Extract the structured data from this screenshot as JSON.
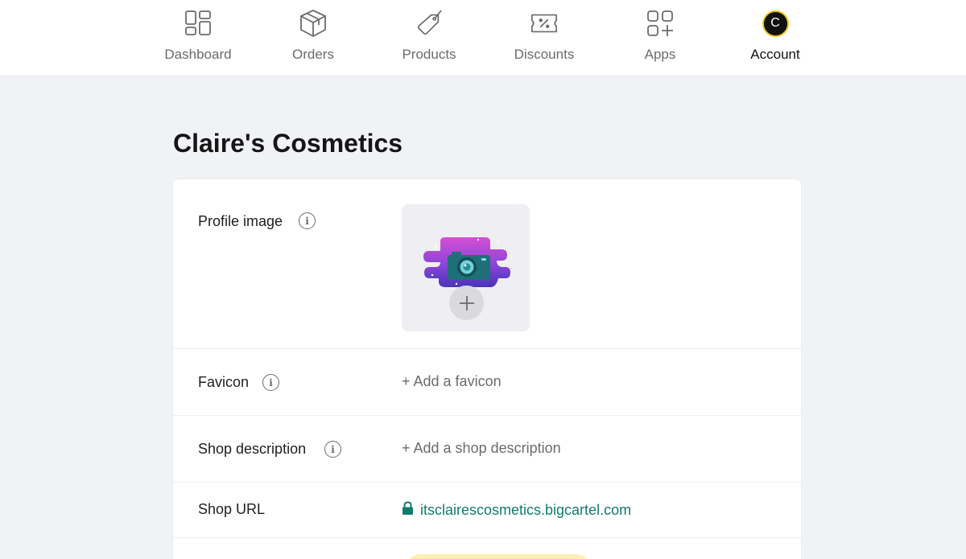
{
  "nav": {
    "items": [
      {
        "label": "Dashboard",
        "icon": "dashboard-icon"
      },
      {
        "label": "Orders",
        "icon": "box-icon"
      },
      {
        "label": "Products",
        "icon": "tag-icon"
      },
      {
        "label": "Discounts",
        "icon": "ticket-icon"
      },
      {
        "label": "Apps",
        "icon": "apps-grid-icon"
      },
      {
        "label": "Account",
        "icon": "avatar",
        "active": true
      }
    ],
    "avatar_initial": "C"
  },
  "page": {
    "title": "Claire's Cosmetics"
  },
  "settings": {
    "profile_image": {
      "label": "Profile image"
    },
    "favicon": {
      "label": "Favicon",
      "action": "+ Add a favicon"
    },
    "shop_description": {
      "label": "Shop description",
      "action": "+ Add a shop description"
    },
    "shop_url": {
      "label": "Shop URL",
      "url": "itsclairescosmetics.bigcartel.com"
    }
  },
  "colors": {
    "accent_link": "#137a6e",
    "background": "#f1f2f6",
    "avatar_ring": "#f0c419"
  }
}
